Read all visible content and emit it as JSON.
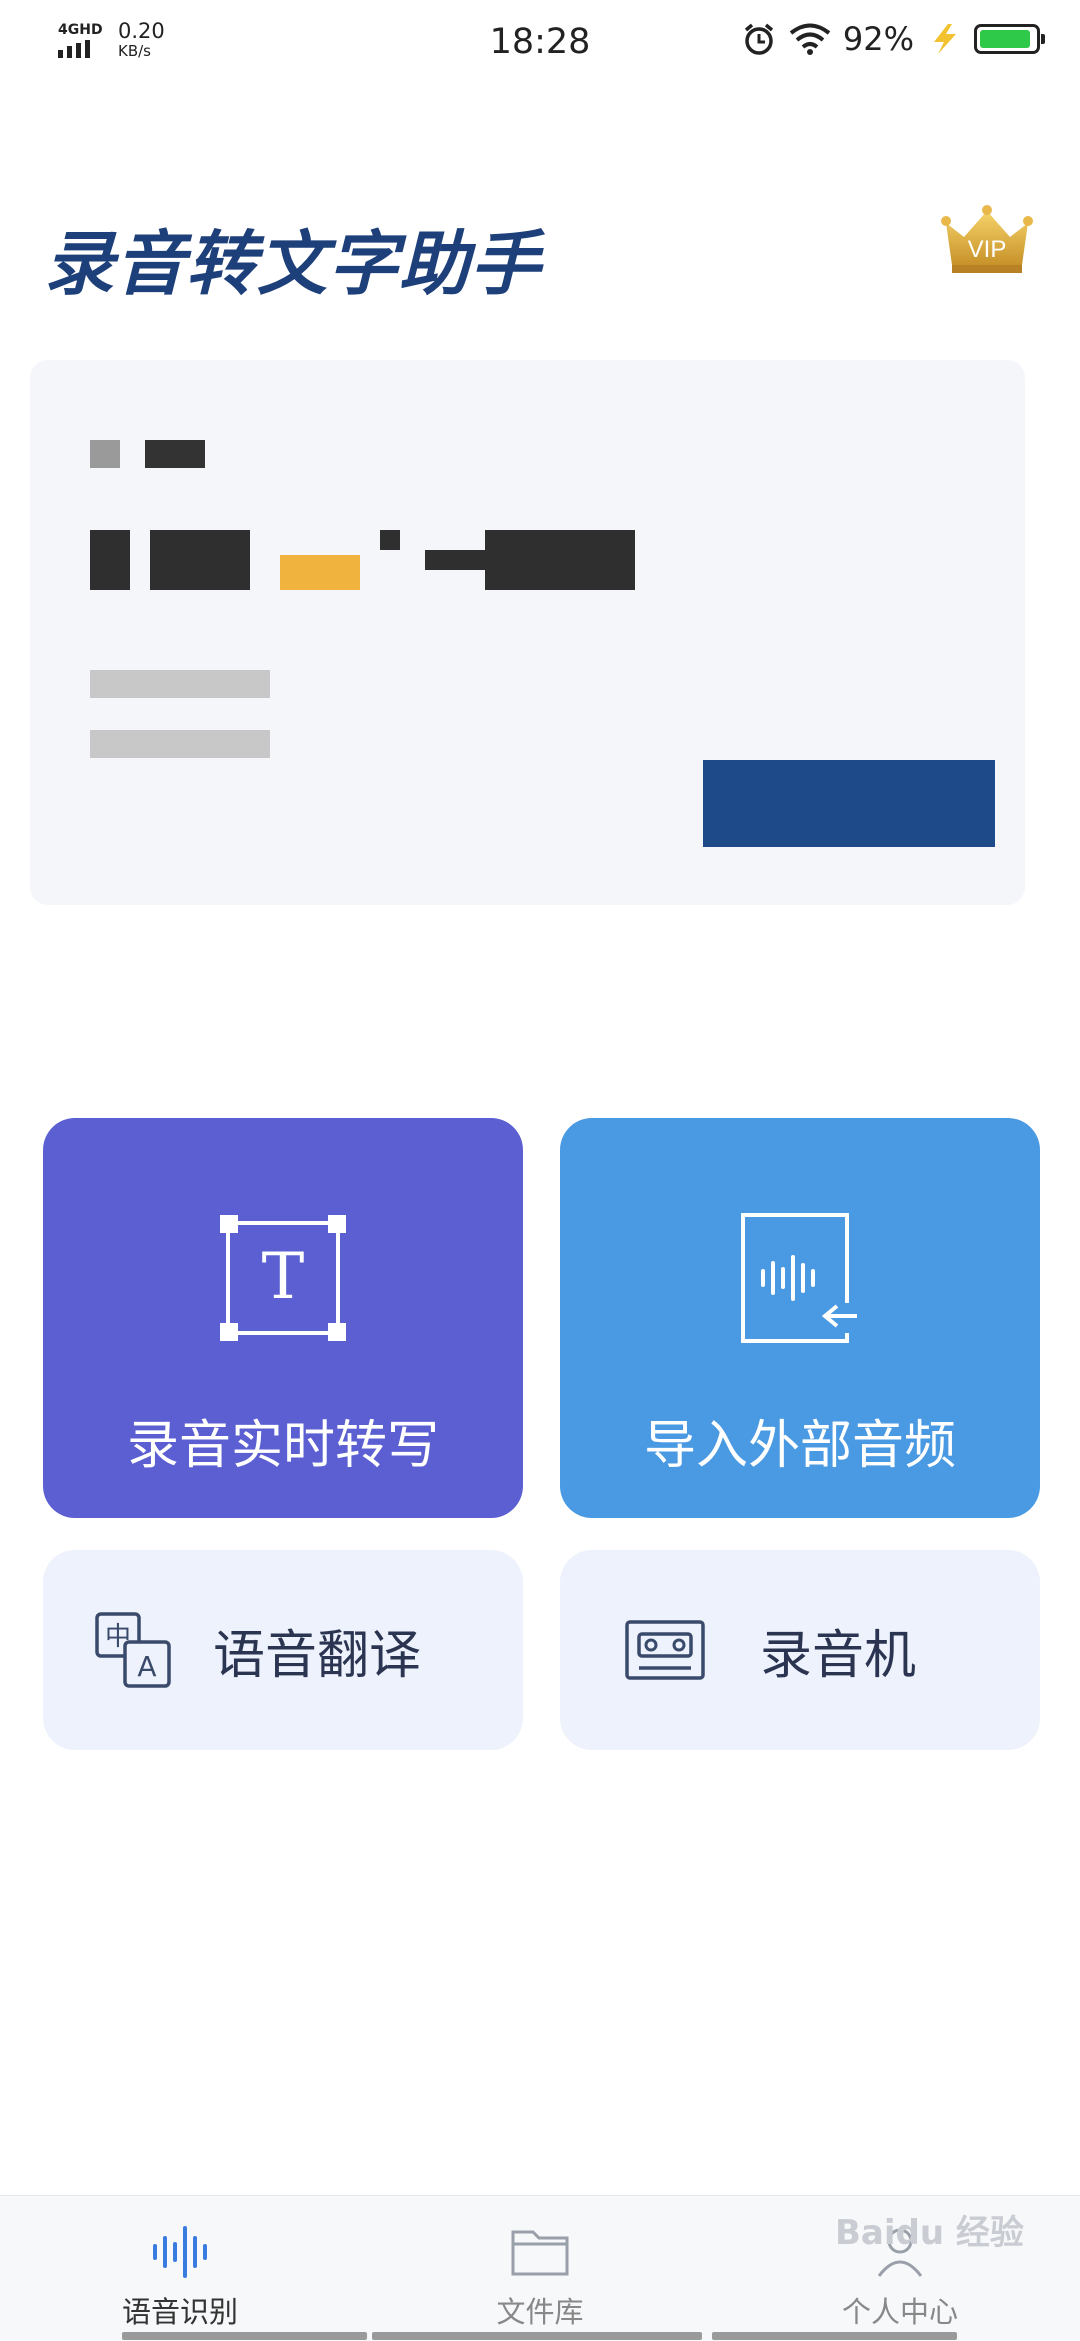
{
  "status_bar": {
    "network": "4GHD",
    "speed_value": "0.20",
    "speed_unit": "KB/s",
    "time": "18:28",
    "battery_percent": "92%",
    "battery_level": 0.92
  },
  "header": {
    "title": "录音转文字助手",
    "vip_label": "VIP"
  },
  "features": {
    "record_realtime": "录音实时转写",
    "import_audio": "导入外部音频",
    "translate": "语音翻译",
    "recorder": "录音机"
  },
  "bottom_nav": {
    "items": [
      {
        "label": "语音识别",
        "icon": "voice-wave-icon",
        "active": true
      },
      {
        "label": "文件库",
        "icon": "folder-icon",
        "active": false
      },
      {
        "label": "个人中心",
        "icon": "person-icon",
        "active": false
      }
    ]
  },
  "watermark": "Baidu 经验",
  "colors": {
    "title": "#1d3f7a",
    "record_card": "#5b5fd1",
    "import_card": "#4a9ae3",
    "small_card": "#edf2fc",
    "active_nav": "#3a7be0"
  }
}
